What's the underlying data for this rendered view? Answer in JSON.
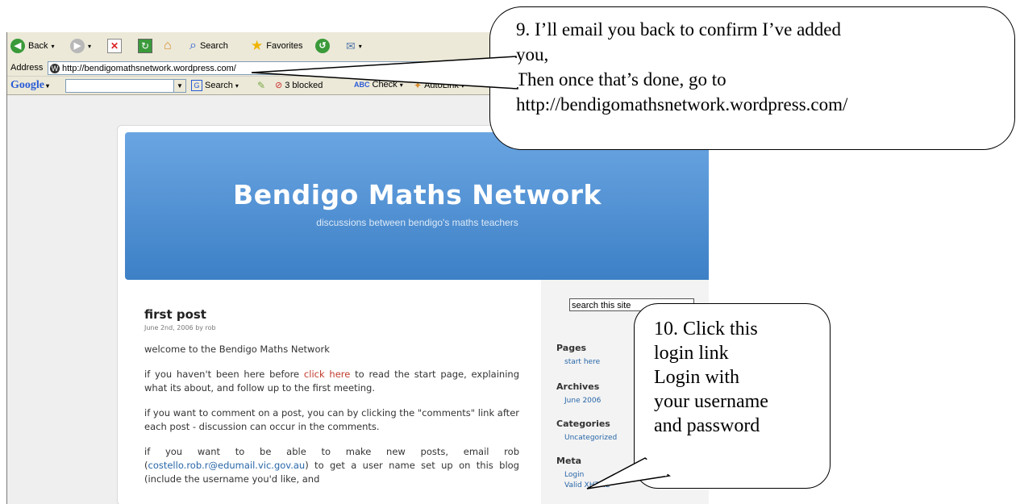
{
  "toolbar": {
    "back_label": "Back",
    "search_label": "Search",
    "favorites_label": "Favorites"
  },
  "address": {
    "label": "Address",
    "url": "http://bendigomathsnetwork.wordpress.com/"
  },
  "google_bar": {
    "logo": "Google",
    "search_label": "Search",
    "blocked_label": "3 blocked",
    "check_label": "Check",
    "autolink_label": "AutoLink"
  },
  "site": {
    "title": "Bendigo Maths Network",
    "tagline": "discussions between bendigo's maths teachers"
  },
  "post": {
    "title": "first post",
    "meta": "June 2nd, 2006 by rob",
    "p1": "welcome to the Bendigo Maths Network",
    "p2_before": "if you haven't been here before ",
    "p2_link": "click here",
    "p2_after": " to read the start page, explaining what its about, and follow up to the first meeting.",
    "p3": "if you want to comment on a post, you can by clicking the \"comments\" link after each post - discussion can occur in the comments.",
    "p4_before": "if you want to be able to make new posts, email rob (",
    "p4_email": "costello.rob.r@edumail.vic.gov.au",
    "p4_after": ") to get a user name set up on this blog (include the username you'd like, and"
  },
  "sidebar": {
    "search_placeholder": "search this site",
    "pages_heading": "Pages",
    "pages_link": "start here",
    "archives_heading": "Archives",
    "archives_link": "June 2006",
    "categories_heading": "Categories",
    "categories_link": "Uncategorized",
    "meta_heading": "Meta",
    "meta_login": "Login",
    "meta_valid": "Valid XHTML"
  },
  "callouts": {
    "step9_line1": "9. I’ll email you back to confirm I’ve added",
    "step9_line2": "you,",
    "step9_line3": "Then once that’s done, go to",
    "step9_line4": "http://bendigomathsnetwork.wordpress.com/",
    "step10_line1": "10. Click this",
    "step10_line2": "login link",
    "step10_line3": "Login with",
    "step10_line4": "your username",
    "step10_line5": "and password"
  },
  "colors": {
    "banner": "#4a8dd2",
    "link": "#2866a8",
    "link_red": "#c0392b"
  }
}
